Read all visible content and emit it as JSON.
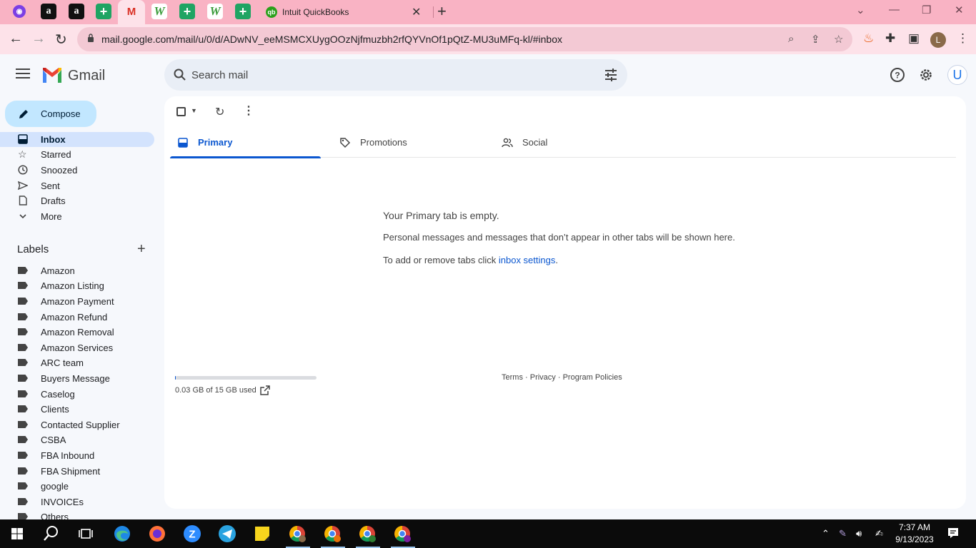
{
  "browser": {
    "active_tab_title": "Intuit QuickBooks",
    "url": "mail.google.com/mail/u/0/d/ADwNV_eeMSMCXUygOOzNjfmuzbh2rfQYVnOf1pQtZ-MU3uMFq-kl/#inbox",
    "profile_initial": "L",
    "tab_icons": [
      "purple-circle-icon",
      "amazon-icon",
      "amazon-icon",
      "google-sheets-icon",
      "gmail-icon",
      "w-app-icon",
      "google-sheets-icon",
      "w-app-icon",
      "google-sheets-icon",
      "quickbooks-icon"
    ]
  },
  "gmail": {
    "app_name": "Gmail",
    "search_placeholder": "Search mail",
    "account_initial": "U",
    "compose_label": "Compose",
    "nav": [
      {
        "label": "Inbox",
        "icon": "inbox-icon",
        "active": true
      },
      {
        "label": "Starred",
        "icon": "star-icon"
      },
      {
        "label": "Snoozed",
        "icon": "clock-icon"
      },
      {
        "label": "Sent",
        "icon": "send-icon"
      },
      {
        "label": "Drafts",
        "icon": "draft-icon"
      },
      {
        "label": "More",
        "icon": "chevron-down-icon"
      }
    ],
    "labels_heading": "Labels",
    "labels": [
      "Amazon",
      "Amazon Listing",
      "Amazon Payment",
      "Amazon Refund",
      "Amazon Removal",
      "Amazon Services",
      "ARC team",
      "Buyers Message",
      "Caselog",
      "Clients",
      "Contacted Supplier",
      "CSBA",
      "FBA Inbound",
      "FBA Shipment",
      "google",
      "INVOICEs",
      "Others"
    ],
    "tabs": [
      {
        "label": "Primary",
        "icon": "inbox-icon",
        "active": true
      },
      {
        "label": "Promotions",
        "icon": "tag-icon"
      },
      {
        "label": "Social",
        "icon": "people-icon"
      }
    ],
    "empty": {
      "title": "Your Primary tab is empty.",
      "description": "Personal messages and messages that don’t appear in other tabs will be shown here.",
      "settings_prefix": "To add or remove tabs click ",
      "settings_link": "inbox settings",
      "settings_suffix": "."
    },
    "storage": {
      "text": "0.03 GB of 15 GB used",
      "fraction": 0.002
    },
    "footer": {
      "terms": "Terms",
      "privacy": "Privacy",
      "policies": "Program Policies",
      "sep": " · "
    }
  },
  "taskbar": {
    "time": "7:37 AM",
    "date": "9/13/2023"
  },
  "colors": {
    "tab_strip": "#f9b3c4",
    "toolbar": "#fde2e9",
    "accent": "#0b57d0",
    "compose": "#c2e7ff",
    "active_nav": "#d3e3fd"
  }
}
